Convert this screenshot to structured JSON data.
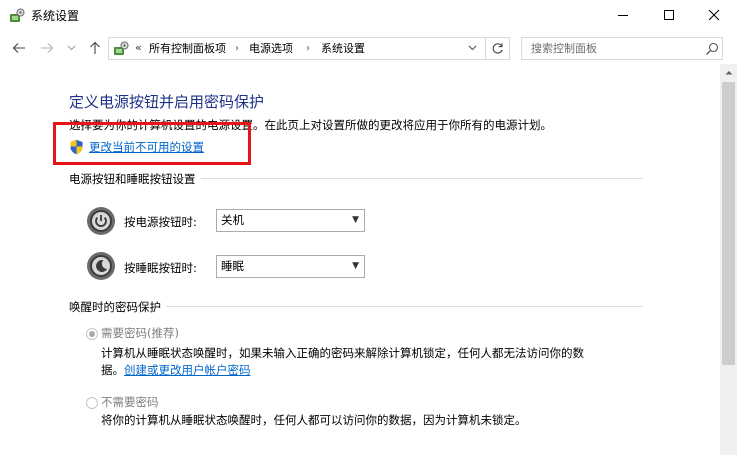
{
  "window": {
    "title": "系统设置",
    "icon": "control-panel-icon",
    "controls": [
      "minimize",
      "maximize",
      "close"
    ]
  },
  "address_bar": {
    "prefix": "«",
    "breadcrumbs": [
      "所有控制面板项",
      "电源选项",
      "系统设置"
    ],
    "separator": "›",
    "search_placeholder": "搜索控制面板"
  },
  "page": {
    "heading": "定义电源按钮并启用密码保护",
    "description": "选择要为你的计算机设置的电源设置。在此页上对设置所做的更改将应用于你所有的电源计划。",
    "change_link": "更改当前不可用的设置",
    "highlight_color": "#e8141a"
  },
  "power_buttons": {
    "group_title": "电源按钮和睡眠按钮设置",
    "power_button_label": "按电源按钮时:",
    "power_button_value": "关机",
    "sleep_button_label": "按睡眠按钮时:",
    "sleep_button_value": "睡眠"
  },
  "wake_password": {
    "group_title": "唤醒时的密码保护",
    "require_label": "需要密码(推荐)",
    "require_checked": true,
    "require_desc_line1": "计算机从睡眠状态唤醒时，如果未输入正确的密码来解除计算机锁定，任何人都无法访问你的数",
    "require_desc_line2_prefix": "据。",
    "require_link": "创建或更改用户帐户密码",
    "no_require_label": "不需要密码",
    "no_require_checked": false,
    "no_require_desc": "将你的计算机从睡眠状态唤醒时，任何人都可以访问你的数据，因为计算机未锁定。"
  },
  "colors": {
    "heading": "#1e3287",
    "link": "#0066cc",
    "disabled_text": "#808080"
  }
}
